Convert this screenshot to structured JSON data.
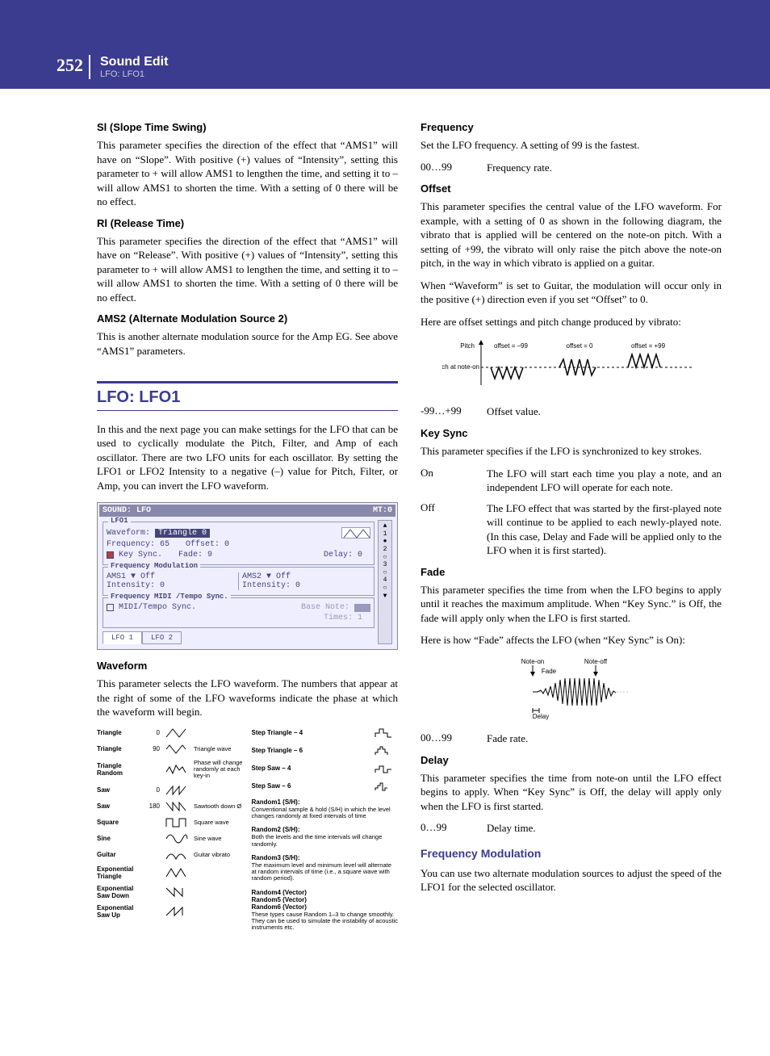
{
  "header": {
    "pagenum": "252",
    "title": "Sound Edit",
    "subtitle": "LFO: LFO1"
  },
  "left": {
    "sl": {
      "title": "Sl (Slope Time Swing)",
      "body": "This parameter specifies the direction of the effect that “AMS1” will have on “Slope”. With positive (+) values of “Intensity”, setting this parameter to + will allow AMS1 to lengthen the time, and setting it to – will allow AMS1 to shorten the time. With a setting of 0 there will be no effect."
    },
    "rl": {
      "title": "Rl (Release Time)",
      "body": "This parameter specifies the direction of the effect that “AMS1” will have on “Release”. With positive (+) values of “Intensity”, setting this parameter to + will allow AMS1 to lengthen the time, and setting it to – will allow AMS1 to shorten the time. With a setting of 0 there will be no effect."
    },
    "ams2": {
      "title": "AMS2 (Alternate Modulation Source 2)",
      "body": "This is another alternate modulation source for the Amp EG. See above “AMS1” parameters."
    },
    "section": "LFO: LFO1",
    "intro": "In this and the next page you can make settings for the LFO that can be used to cyclically modulate the Pitch, Filter, and Amp of each oscillator. There are two LFO units for each oscillator. By setting the LFO1 or LFO2 Intensity to a negative (–) value for Pitch, Filter, or Amp, you can invert the LFO waveform.",
    "screenshot": {
      "title_l": "SOUND: LFO",
      "title_r": "MT:0",
      "panel1": "LFO1",
      "waveform_l": "Waveform:",
      "waveform_v": "Triangle 0",
      "freq_l": "Frequency: 65",
      "offset_l": "Offset: 0",
      "keysync_l": "Key Sync.",
      "fade_l": "Fade:   9",
      "delay_l": "Delay:   0",
      "panel2": "Frequency Modulation",
      "ams1_l": "AMS1 ",
      "ams1_v": "Off",
      "ams2_l": "AMS2 ",
      "ams2_v": "Off",
      "int1": "Intensity: 0",
      "int2": "Intensity: 0",
      "panel3": "Frequency MIDI /Tempo Sync.",
      "miditempo": "MIDI/Tempo Sync.",
      "basenote": "Base Note:",
      "times": "Times:    1",
      "tab1": "LFO 1",
      "tab2": "LFO 2"
    },
    "waveform": {
      "title": "Waveform",
      "body": "This parameter selects the LFO waveform. The numbers that appear at the right of some of the LFO waveforms indicate the phase at which the waveform will begin.",
      "items_left": [
        {
          "name": "Triangle",
          "num": "0",
          "desc": ""
        },
        {
          "name": "Triangle",
          "num": "90",
          "desc": "Triangle wave"
        },
        {
          "name": "Triangle Random",
          "num": "",
          "desc": "Phase will change randomly at each key-in"
        },
        {
          "name": "Saw",
          "num": "0",
          "desc": ""
        },
        {
          "name": "Saw",
          "num": "180",
          "desc": "Sawtooth down Ø"
        },
        {
          "name": "Square",
          "num": "",
          "desc": "Square wave"
        },
        {
          "name": "Sine",
          "num": "",
          "desc": "Sine wave"
        },
        {
          "name": "Guitar",
          "num": "",
          "desc": "Guitar vibrato"
        },
        {
          "name": "Exponential Triangle",
          "num": "",
          "desc": ""
        },
        {
          "name": "Exponential Saw Down",
          "num": "",
          "desc": ""
        },
        {
          "name": "Exponential Saw Up",
          "num": "",
          "desc": ""
        }
      ],
      "items_right": [
        {
          "name": "Step Triangle – 4",
          "desc": ""
        },
        {
          "name": "Step Triangle – 6",
          "desc": ""
        },
        {
          "name": "Step Saw – 4",
          "desc": ""
        },
        {
          "name": "Step Saw – 6",
          "desc": ""
        },
        {
          "name": "Random1 (S/H):",
          "desc": "Conventional sample & hold (S/H) in which the level changes randomly at fixed intervals of time"
        },
        {
          "name": "Random2 (S/H):",
          "desc": "Both the levels and the time intervals will change randomly."
        },
        {
          "name": "Random3 (S/H):",
          "desc": "The maximum level and minimum level will alternate at random intervals of time (i.e., a square wave with random period)."
        },
        {
          "name": "Random4 (Vector)\nRandom5 (Vector)\nRandom6 (Vector)",
          "desc": "These types cause Random 1–3 to change smoothly. They can be used to simulate the instability of acoustic instruments etc."
        }
      ]
    }
  },
  "right": {
    "frequency": {
      "title": "Frequency",
      "body": "Set the LFO frequency. A setting of 99 is the fastest.",
      "range": "00…99",
      "range_desc": "Frequency rate."
    },
    "offset": {
      "title": "Offset",
      "body1": "This parameter specifies the central value of the LFO waveform. For example, with a setting of 0 as shown in the following diagram, the vibrato that is applied will be centered on the note-on pitch. With a setting of +99, the vibrato will only raise the pitch above the note-on pitch, in the way in which vibrato is applied on a guitar.",
      "body2": "When “Waveform” is set to Guitar, the modulation will occur only in the positive (+) direction even if you set “Offset” to 0.",
      "body3": "Here are offset settings and pitch change produced by vibrato:",
      "diag": {
        "pitch": "Pitch",
        "noteon": "Pitch at note-on",
        "m99": "offset = –99",
        "z": "offset = 0",
        "p99": "offset = +99"
      },
      "range": "-99…+99",
      "range_desc": "Offset value."
    },
    "keysync": {
      "title": "Key Sync",
      "body": "This parameter specifies if the LFO is synchronized to key strokes.",
      "on_k": "On",
      "on_v": "The LFO will start each time you play a note, and an independent LFO will operate for each note.",
      "off_k": "Off",
      "off_v": "The LFO effect that was started by the first-played note will continue to be applied to each newly-played note. (In this case, Delay and Fade will be applied only to the LFO when it is first started)."
    },
    "fade": {
      "title": "Fade",
      "body1": "This parameter specifies the time from when the LFO begins to apply until it reaches the maximum amplitude. When “Key Sync.” is Off, the fade will apply only when the LFO is first started.",
      "body2": "Here is how “Fade” affects the LFO (when “Key Sync” is On):",
      "diag": {
        "noteon": "Note-on",
        "noteoff": "Note-off",
        "fade": "Fade",
        "delay": "Delay"
      },
      "range": "00…99",
      "range_desc": "Fade rate."
    },
    "delay": {
      "title": "Delay",
      "body": "This parameter specifies the time from note-on until the LFO effect begins to apply. When “Key Sync” is Off, the delay will apply only when the LFO is first started.",
      "range": "0…99",
      "range_desc": "Delay time."
    },
    "fm": {
      "title": "Frequency Modulation",
      "body": "You can use two alternate modulation sources to adjust the speed of the LFO1 for the selected oscillator."
    }
  }
}
